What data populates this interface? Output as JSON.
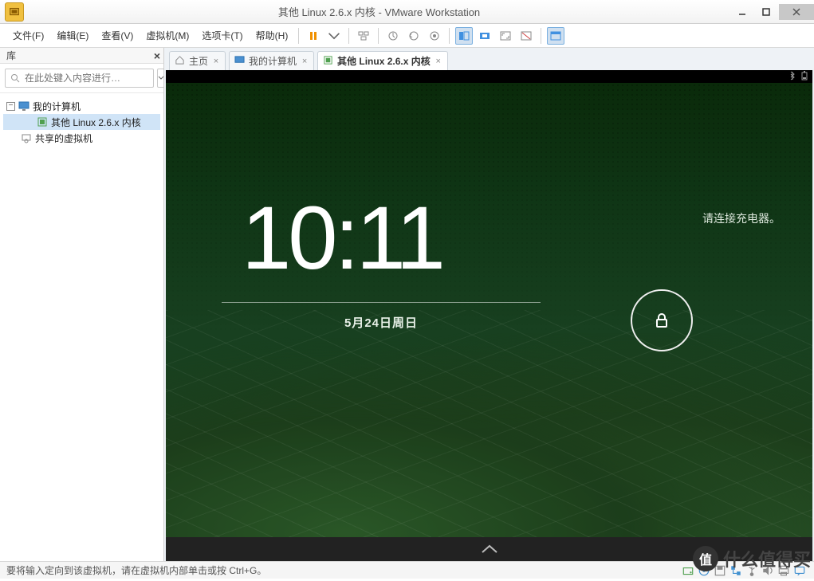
{
  "window": {
    "title": "其他 Linux 2.6.x 内核 - VMware Workstation"
  },
  "menu": {
    "file": "文件(F)",
    "edit": "编辑(E)",
    "view": "查看(V)",
    "vm": "虚拟机(M)",
    "tabs": "选项卡(T)",
    "help": "帮助(H)"
  },
  "sidebar": {
    "header": "库",
    "search_placeholder": "在此处键入内容进行…",
    "tree": {
      "root": "我的计算机",
      "vm": "其他 Linux 2.6.x 内核",
      "shared": "共享的虚拟机"
    }
  },
  "tabs": {
    "home": "主页",
    "mycomputer": "我的计算机",
    "active": "其他 Linux 2.6.x 内核"
  },
  "android": {
    "time": "10:11",
    "date": "5月24日周日",
    "charger_msg": "请连接充电器。"
  },
  "statusbar": {
    "hint": "要将输入定向到该虚拟机，请在虚拟机内部单击或按 Ctrl+G。"
  },
  "watermark": {
    "badge": "值",
    "text": "什么值得买"
  }
}
